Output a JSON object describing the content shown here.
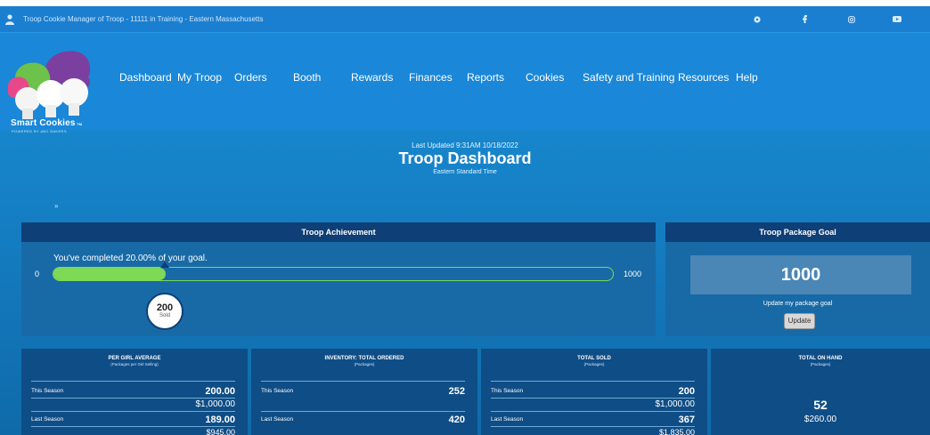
{
  "topbar": {
    "title": "Troop Cookie Manager of Troop - 11111 in Training - Eastern Massachusetts"
  },
  "logo": {
    "brand": "Smart Cookies",
    "tm": "TM",
    "powered": "POWERED BY ABC BAKERS"
  },
  "nav": [
    {
      "label": "Dashboard"
    },
    {
      "label": "My Troop"
    },
    {
      "label": "Orders"
    },
    {
      "label": "Booth"
    },
    {
      "label": "Rewards"
    },
    {
      "label": "Finances"
    },
    {
      "label": "Reports"
    },
    {
      "label": "Cookies"
    },
    {
      "label": "Safety and Training"
    },
    {
      "label": "Resources"
    },
    {
      "label": "Help"
    }
  ],
  "header": {
    "updated": "Last Updated 9:31AM 10/18/2022",
    "title": "Troop Dashboard",
    "timezone": "Eastern Standard Time",
    "breadcrumb": "»"
  },
  "achievement": {
    "title": "Troop Achievement",
    "message": "You've completed 20.00% of your goal.",
    "min": "0",
    "max": "1000",
    "sold": "200",
    "sold_label": "Sold",
    "progress_fraction": 0.2
  },
  "goal": {
    "title": "Troop Package Goal",
    "value": "1000",
    "link": "Update my package goal",
    "button": "Update"
  },
  "cards": {
    "per_girl": {
      "title": "PER GIRL AVERAGE",
      "sub": "(Packages per Girl Selling)",
      "this_label": "This Season",
      "this_pkg": "200.00",
      "this_amt": "$1,000.00",
      "last_label": "Last Season",
      "last_pkg": "189.00",
      "last_amt": "$945.00"
    },
    "inventory": {
      "title": "INVENTORY: TOTAL ORDERED",
      "sub": "(Packages)",
      "this_label": "This Season",
      "this_pkg": "252",
      "last_label": "Last Season",
      "last_pkg": "420"
    },
    "total_sold": {
      "title": "TOTAL SOLD",
      "sub": "(Packages)",
      "this_label": "This Season",
      "this_pkg": "200",
      "this_amt": "$1,000.00",
      "last_label": "Last Season",
      "last_pkg": "367",
      "last_amt": "$1,835.00"
    },
    "on_hand": {
      "title": "TOTAL ON HAND",
      "sub": "(Packages)",
      "pkg": "52",
      "amt": "$260.00"
    }
  },
  "colors": {
    "accent_green": "#7ed957",
    "panel_header": "#0e3f76",
    "nav_blue": "#1a87d8"
  },
  "icons": [
    "user-icon",
    "help-icon",
    "facebook-icon",
    "instagram-icon",
    "youtube-icon"
  ]
}
